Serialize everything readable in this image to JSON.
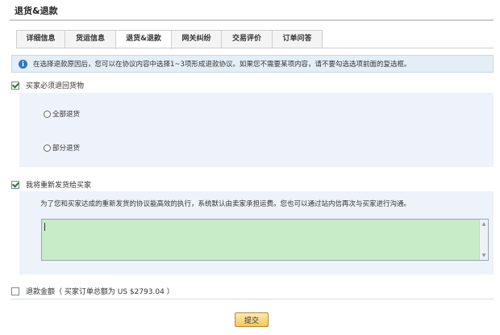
{
  "page": {
    "title": "退货&退款"
  },
  "tabs": [
    {
      "label": "详细信息",
      "active": false
    },
    {
      "label": "货运信息",
      "active": false
    },
    {
      "label": "退货&退款",
      "active": true
    },
    {
      "label": "网关纠纷",
      "active": false
    },
    {
      "label": "交易评价",
      "active": false
    },
    {
      "label": "订单问答",
      "active": false
    }
  ],
  "info": {
    "icon": "info-icon",
    "icon_glyph": "i",
    "text": "在选择退款原因后，您可以在协议内容中选择1~3项形成退款协议。如果您不需要某项内容，请不要勾选选项前面的复选框。"
  },
  "return_goods": {
    "label": "买家必须退回货物",
    "checked": true,
    "options": [
      {
        "label": "全部退货",
        "selected": false
      },
      {
        "label": "部分退货",
        "selected": false
      }
    ]
  },
  "reship": {
    "label": "我将重新发货给买家",
    "checked": true,
    "hint": "为了您和买家达成的重新发货的协议能高效的执行，系统默认由卖家承担运费。您也可以通过站内信再次与买家进行沟通。",
    "textarea_value": "",
    "scroll_up": "▲",
    "scroll_down": "▼"
  },
  "refund": {
    "label": "退款金额（ 买家订单总额为 US $2793.04 ）",
    "checked": false
  },
  "submit_label": "提交",
  "colors": {
    "info_bg": "#e4eef6",
    "info_icon": "#2b76c0",
    "panel_bg": "#edf2fb",
    "textarea_bg": "#c8ecc8",
    "submit_bg": "#f4c760"
  }
}
